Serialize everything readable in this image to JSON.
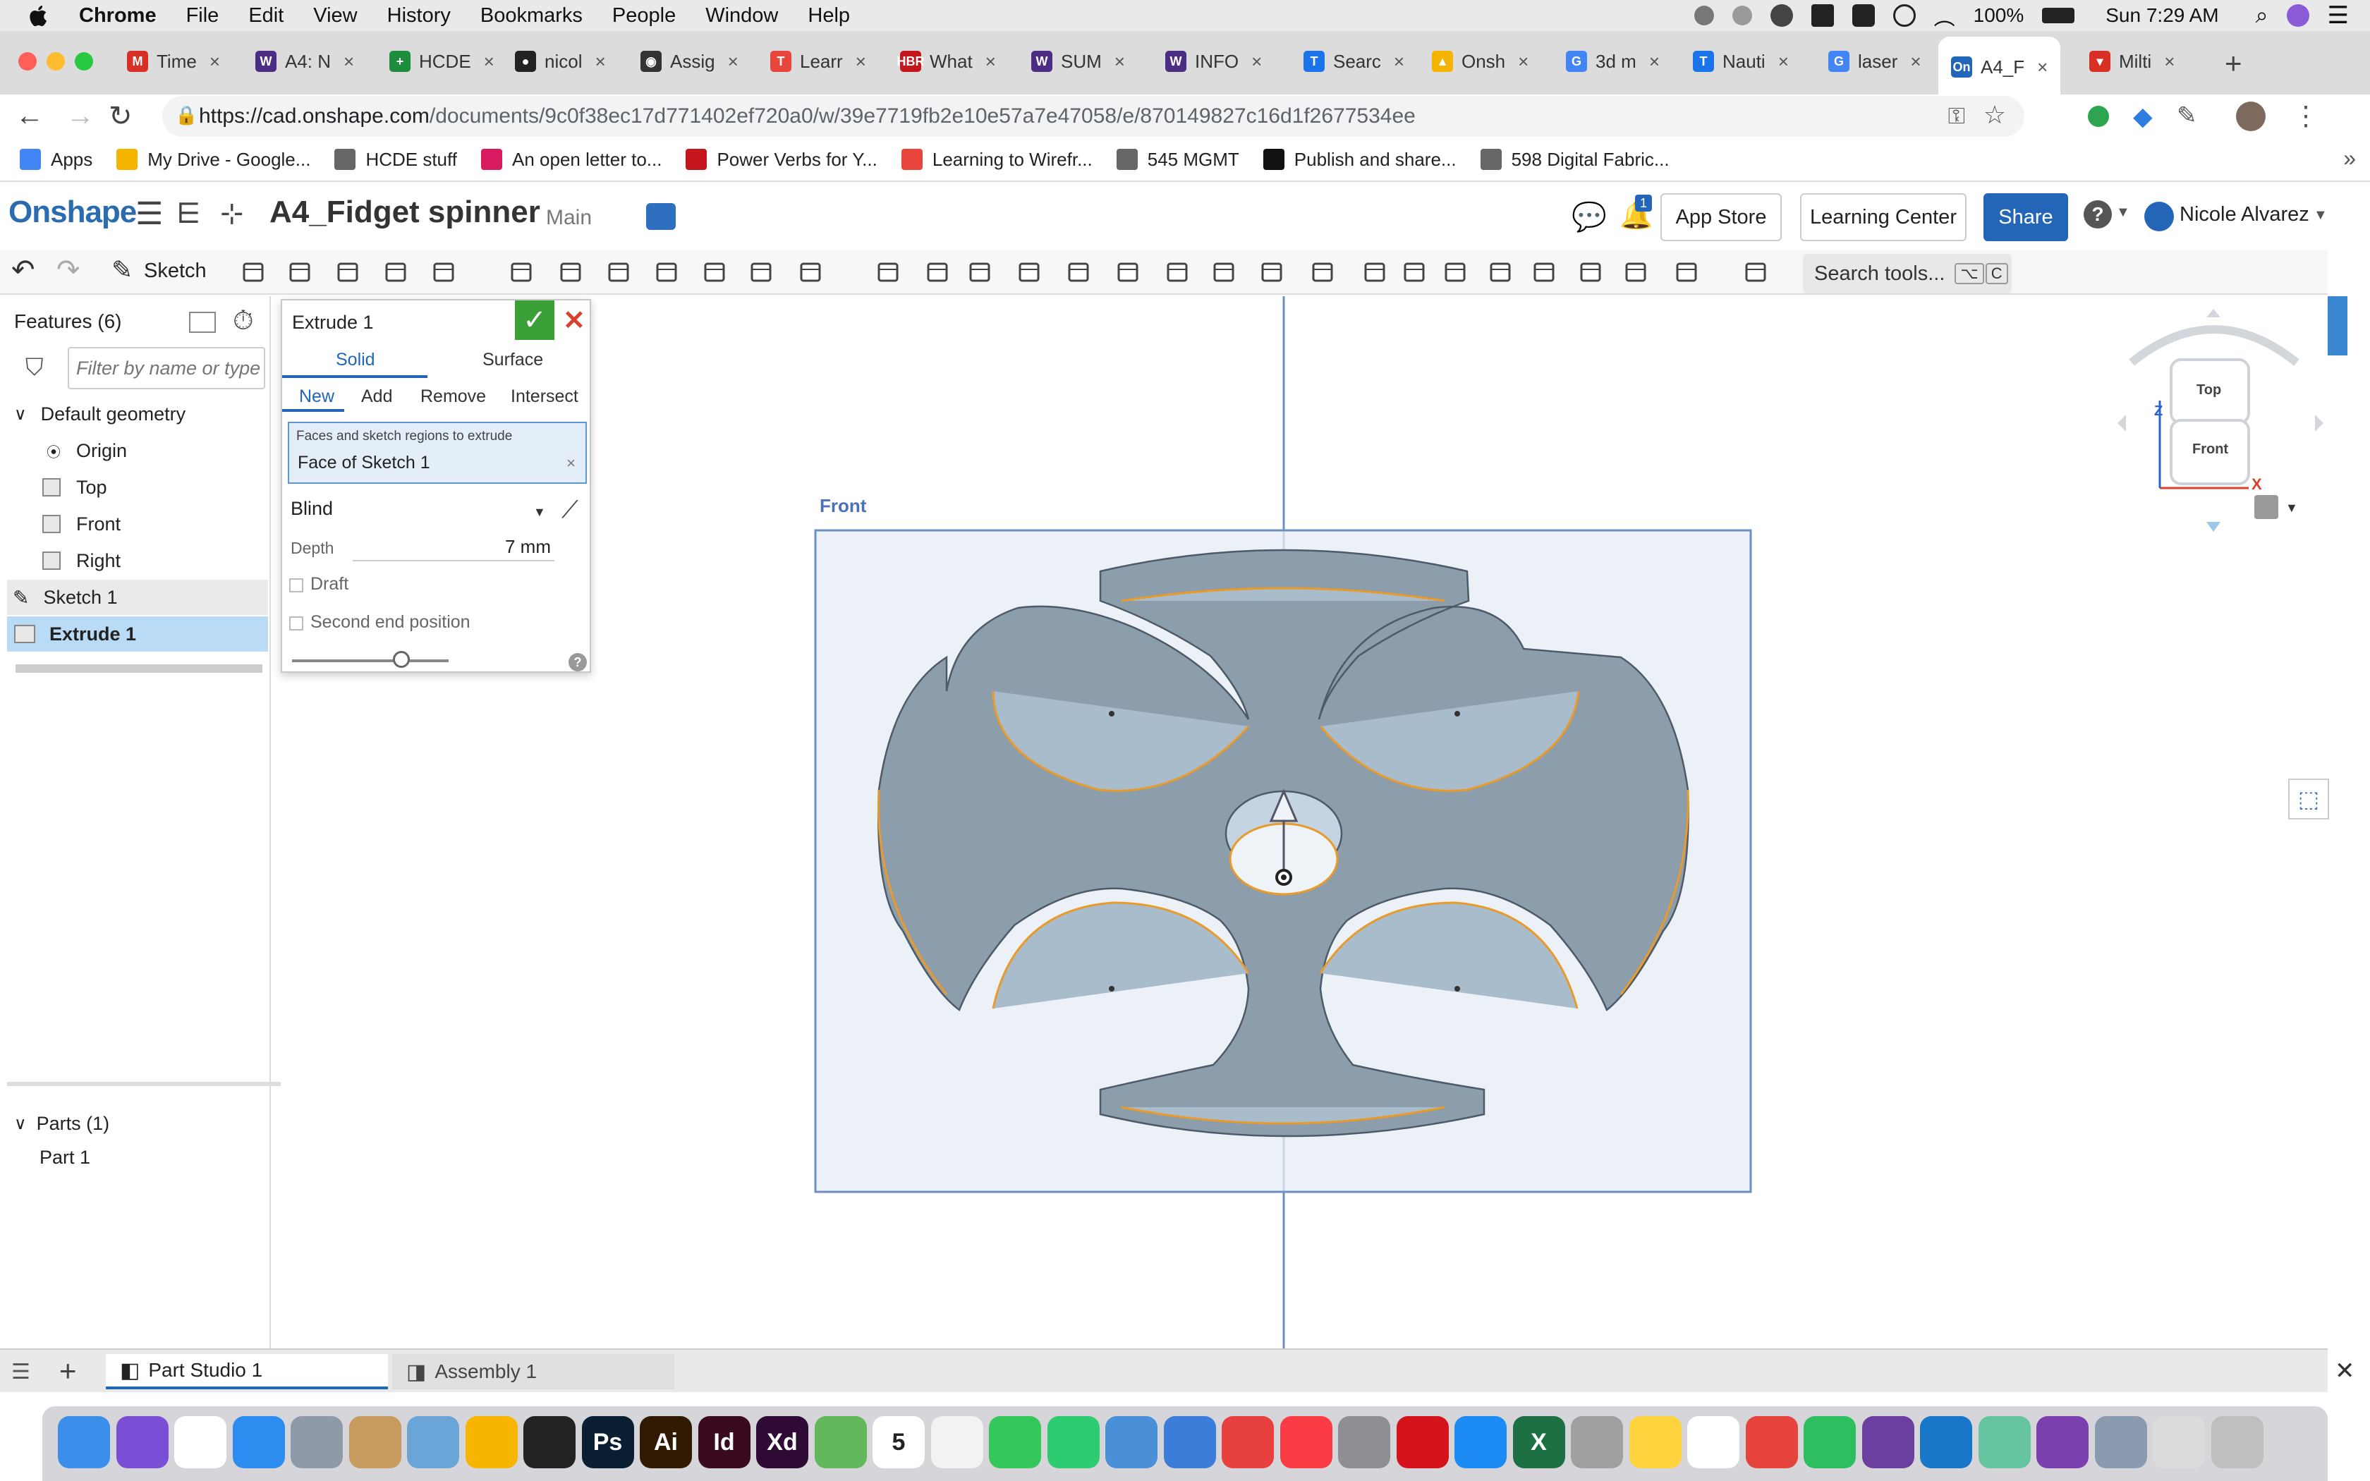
{
  "menubar": {
    "app": "Chrome",
    "items": [
      "File",
      "Edit",
      "View",
      "History",
      "Bookmarks",
      "People",
      "Window",
      "Help"
    ],
    "battery": "100%",
    "clock": "Sun 7:29 AM"
  },
  "tabs": [
    {
      "label": "Time",
      "fav_color": "#d93025",
      "fav_glyph": "M"
    },
    {
      "label": "A4: N",
      "fav_color": "#4b2e83",
      "fav_glyph": "W"
    },
    {
      "label": "HCDE",
      "fav_color": "#1e8e3e",
      "fav_glyph": "+"
    },
    {
      "label": "nicol",
      "fav_color": "#222222",
      "fav_glyph": "●"
    },
    {
      "label": "Assig",
      "fav_color": "#333333",
      "fav_glyph": "◉"
    },
    {
      "label": "Learr",
      "fav_color": "#e8453c",
      "fav_glyph": "T"
    },
    {
      "label": "What",
      "fav_color": "#c4161c",
      "fav_glyph": "HBR"
    },
    {
      "label": "SUM",
      "fav_color": "#4b2e83",
      "fav_glyph": "W"
    },
    {
      "label": "INFO",
      "fav_color": "#4b2e83",
      "fav_glyph": "W"
    },
    {
      "label": "Searc",
      "fav_color": "#1a73e8",
      "fav_glyph": "T"
    },
    {
      "label": "Onsh",
      "fav_color": "#f4b400",
      "fav_glyph": "▲"
    },
    {
      "label": "3d m",
      "fav_color": "#4285f4",
      "fav_glyph": "G"
    },
    {
      "label": "Nauti",
      "fav_color": "#1a73e8",
      "fav_glyph": "T"
    },
    {
      "label": "laser",
      "fav_color": "#4285f4",
      "fav_glyph": "G"
    },
    {
      "label": "A4_F",
      "fav_color": "#2366b8",
      "fav_glyph": "On"
    },
    {
      "label": "Milti",
      "fav_color": "#d93025",
      "fav_glyph": "▾"
    }
  ],
  "url": {
    "host": "https://cad.onshape.com",
    "path": "/documents/9c0f38ec17d771402ef720a0/w/39e7719fb2e10e57a7e47058/e/870149827c16d1f2677534ee"
  },
  "bookmarks": [
    {
      "label": "Apps",
      "color": "#4285f4"
    },
    {
      "label": "My Drive - Google...",
      "color": "#f4b400"
    },
    {
      "label": "HCDE stuff",
      "color": "#666666"
    },
    {
      "label": "An open letter to...",
      "color": "#d81b60"
    },
    {
      "label": "Power Verbs for Y...",
      "color": "#c4161c"
    },
    {
      "label": "Learning to Wirefr...",
      "color": "#e8453c"
    },
    {
      "label": "545 MGMT",
      "color": "#666666"
    },
    {
      "label": "Publish and share...",
      "color": "#111111"
    },
    {
      "label": "598 Digital Fabric...",
      "color": "#666666"
    }
  ],
  "header": {
    "logo": "Onshape",
    "doc_title": "A4_Fidget spinner",
    "branch": "Main",
    "notif_count": "1",
    "app_store": "App Store",
    "learning_center": "Learning Center",
    "share": "Share",
    "user": "Nicole Alvarez"
  },
  "toolbar": {
    "sketch": "Sketch",
    "search_tools": "Search tools...",
    "shortcut_1": "⌥",
    "shortcut_2": "C"
  },
  "features": {
    "header": "Features (6)",
    "filter_placeholder": "Filter by name or type",
    "default_geometry": "Default geometry",
    "items": [
      "Origin",
      "Top",
      "Front",
      "Right"
    ],
    "sketch": "Sketch 1",
    "extrude": "Extrude 1",
    "parts_header": "Parts (1)",
    "part": "Part 1"
  },
  "extrude_dialog": {
    "title": "Extrude 1",
    "tab_solid": "Solid",
    "tab_surface": "Surface",
    "op_new": "New",
    "op_add": "Add",
    "op_remove": "Remove",
    "op_intersect": "Intersect",
    "faces_label": "Faces and sketch regions to extrude",
    "faces_value": "Face of Sketch 1",
    "end_type": "Blind",
    "depth_label": "Depth",
    "depth_value": "7 mm",
    "draft": "Draft",
    "second_end": "Second end position",
    "slider_fraction": 0.7
  },
  "viewport": {
    "plane_label": "Front",
    "view_cube_top": "Top",
    "view_cube_front": "Front",
    "axis_z": "Z",
    "axis_x": "X"
  },
  "bottom_tabs": {
    "part_studio": "Part Studio 1",
    "assembly": "Assembly 1"
  },
  "dock": {
    "apps": [
      {
        "name": "finder",
        "color": "#3b8eea"
      },
      {
        "name": "siri",
        "color": "#7a4fd6"
      },
      {
        "name": "chrome",
        "color": "#ffffff"
      },
      {
        "name": "safari",
        "color": "#2d8cf0"
      },
      {
        "name": "launchpad",
        "color": "#8e9aa8"
      },
      {
        "name": "contacts",
        "color": "#c79a5d"
      },
      {
        "name": "preview",
        "color": "#6aa5d8"
      },
      {
        "name": "sketch",
        "color": "#f7b500"
      },
      {
        "name": "figma",
        "color": "#222222"
      },
      {
        "name": "ps",
        "color": "#0b1f33",
        "glyph": "Ps"
      },
      {
        "name": "ai",
        "color": "#321a02",
        "glyph": "Ai"
      },
      {
        "name": "id",
        "color": "#3a0a1e",
        "glyph": "Id"
      },
      {
        "name": "xd",
        "color": "#2e0a34",
        "glyph": "Xd"
      },
      {
        "name": "maps",
        "color": "#64b85c"
      },
      {
        "name": "calendar",
        "color": "#ffffff",
        "glyph": "5"
      },
      {
        "name": "photos",
        "color": "#f2f2f2"
      },
      {
        "name": "messages",
        "color": "#34c759"
      },
      {
        "name": "facetime",
        "color": "#2ecc71"
      },
      {
        "name": "keynote-doc",
        "color": "#4a90d9"
      },
      {
        "name": "keynote",
        "color": "#3b7dd8"
      },
      {
        "name": "news",
        "color": "#e83f3f"
      },
      {
        "name": "music",
        "color": "#fc3c44"
      },
      {
        "name": "settings",
        "color": "#8e8e93"
      },
      {
        "name": "acrobat",
        "color": "#d4141a"
      },
      {
        "name": "app-store",
        "color": "#1c8bf3"
      },
      {
        "name": "excel",
        "color": "#1d7044",
        "glyph": "X"
      },
      {
        "name": "numbers",
        "color": "#a0a0a0"
      },
      {
        "name": "notes",
        "color": "#ffd33d"
      },
      {
        "name": "slack",
        "color": "#ffffff"
      },
      {
        "name": "reeder",
        "color": "#e5433c"
      },
      {
        "name": "evernote",
        "color": "#2dbe60"
      },
      {
        "name": "pockity",
        "color": "#6b3fa0"
      },
      {
        "name": "instruments",
        "color": "#1877c9"
      },
      {
        "name": "atom",
        "color": "#66c5a0"
      },
      {
        "name": "github",
        "color": "#7b3fb0"
      },
      {
        "name": "image-capture",
        "color": "#8a9bb0"
      },
      {
        "name": "folder",
        "color": "#dcdcdc"
      },
      {
        "name": "trash",
        "color": "#bfbfbf"
      }
    ]
  }
}
